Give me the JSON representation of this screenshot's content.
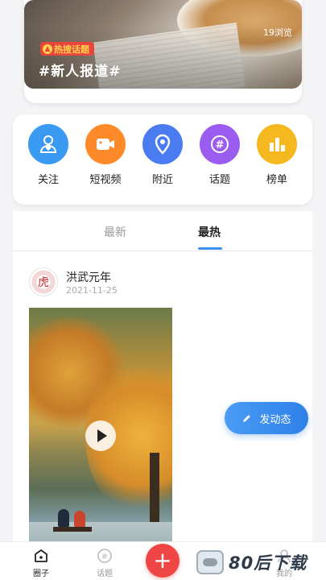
{
  "banner": {
    "views": "19浏览",
    "hot_badge": "热搜话题",
    "title": "#新人报道#"
  },
  "quick_nav": [
    {
      "label": "关注",
      "icon": "user-heart-icon",
      "color": "#3a9af2"
    },
    {
      "label": "短视频",
      "icon": "video-icon",
      "color": "#ff8a2a"
    },
    {
      "label": "附近",
      "icon": "location-pin-icon",
      "color": "#4b7bf0"
    },
    {
      "label": "话题",
      "icon": "hashtag-icon",
      "color": "#9b5cf0"
    },
    {
      "label": "榜单",
      "icon": "bar-chart-icon",
      "color": "#f6b81f"
    }
  ],
  "tabs": {
    "latest": "最新",
    "hot": "最热",
    "active": "hot"
  },
  "post": {
    "author": "洪武元年",
    "date": "2021-11-25",
    "avatar_char": "虎"
  },
  "fab": {
    "label": "发动态"
  },
  "bottom_nav": {
    "home": "圈子",
    "topic": "话题",
    "me": "我的"
  },
  "watermark": {
    "text": "80后下载"
  }
}
